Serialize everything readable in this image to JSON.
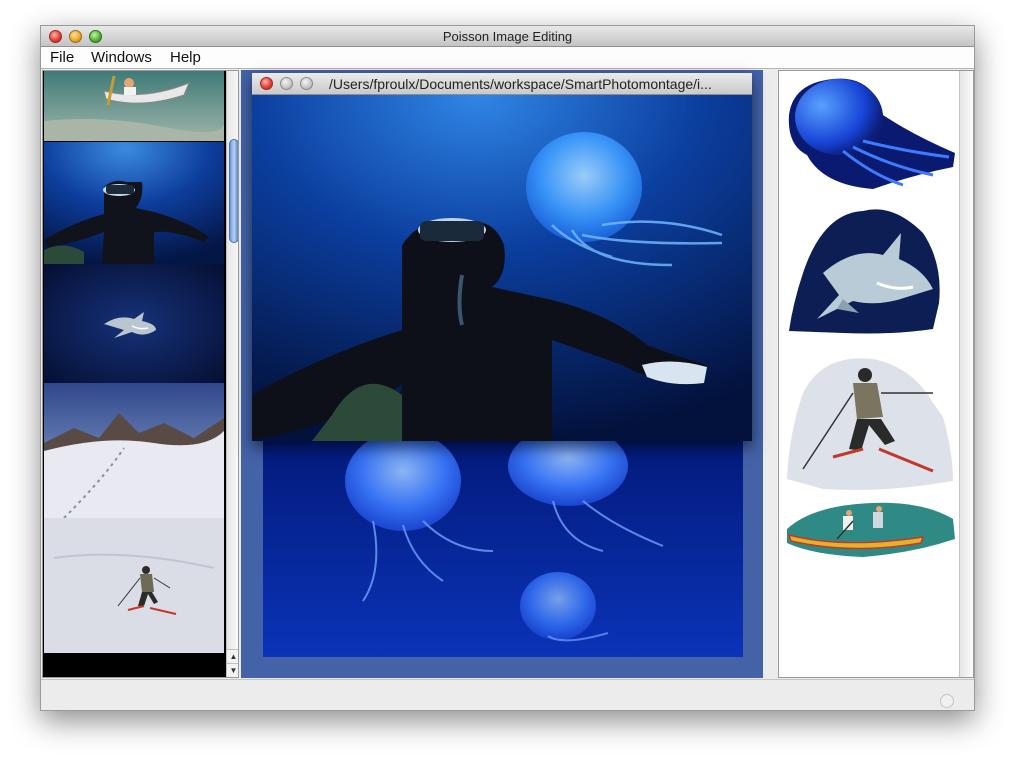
{
  "window": {
    "title": "Poisson Image Editing"
  },
  "menu": {
    "file": "File",
    "windows": "Windows",
    "help": "Help"
  },
  "document": {
    "path": "/Users/fproulx/Documents/workspace/SmartPhotomontage/i..."
  },
  "image_strip": {
    "items": [
      {
        "name": "kayak-photo",
        "subject": "people in a kayak on water"
      },
      {
        "name": "diver-photo",
        "subject": "scuba diver underwater"
      },
      {
        "name": "shark-photo",
        "subject": "shark in deep blue water"
      },
      {
        "name": "snow-mountain-photo",
        "subject": "snowy mountain with footprints"
      },
      {
        "name": "skier-photo",
        "subject": "skier on snow slope"
      }
    ]
  },
  "cutouts": {
    "items": [
      {
        "name": "jellyfish-cutout"
      },
      {
        "name": "shark-cutout"
      },
      {
        "name": "skier-cutout"
      },
      {
        "name": "canoe-cutout"
      }
    ]
  },
  "colors": {
    "canvas_background": "#4362a8",
    "scroll_thumb": "#6a9ad6"
  }
}
